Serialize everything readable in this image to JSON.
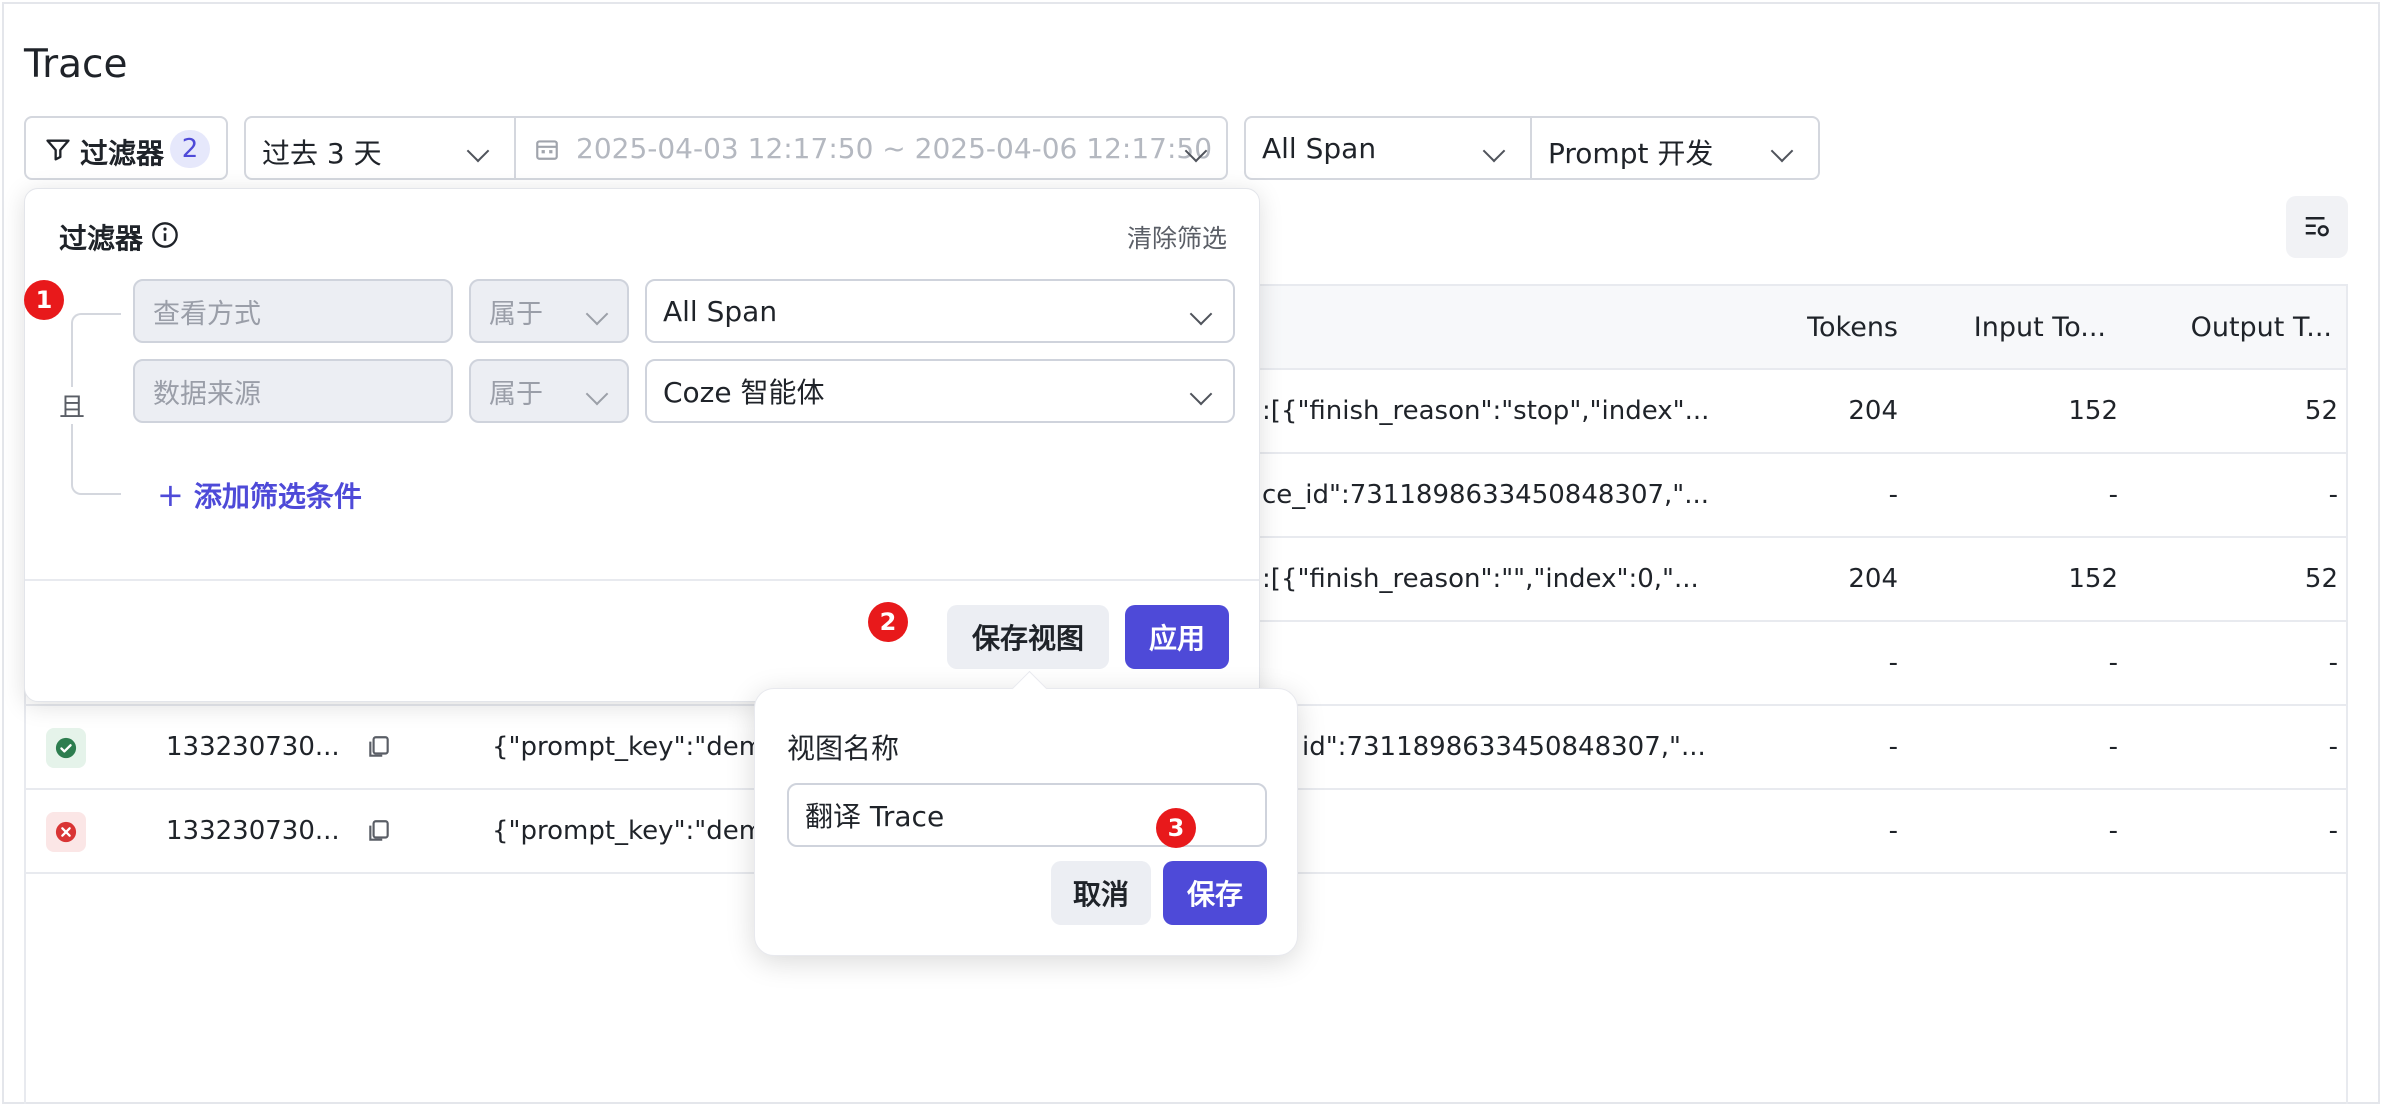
{
  "page": {
    "title": "Trace"
  },
  "toolbar": {
    "filter_label": "过滤器",
    "filter_count": "2",
    "time_range": "过去 3 天",
    "date_range": "2025-04-03 12:17:50 ~ 2025-04-06 12:17:50",
    "span_type": "All Span",
    "platform": "Prompt 开发"
  },
  "table": {
    "headers": {
      "tokens": "Tokens",
      "input_tokens": "Input To...",
      "output_tokens": "Output T..."
    },
    "rows": [
      {
        "status": "",
        "id": "",
        "input": "",
        "output": ":[{\"finish_reason\":\"stop\",\"index\"...",
        "tokens": "204",
        "input_tokens": "152",
        "output_tokens": "52"
      },
      {
        "status": "",
        "id": "",
        "input": "",
        "output": "ce_id\":7311898633450848307,\"...",
        "tokens": "-",
        "input_tokens": "-",
        "output_tokens": "-"
      },
      {
        "status": "",
        "id": "",
        "input": "",
        "output": ":[{\"finish_reason\":\"\",\"index\":0,\"...",
        "tokens": "204",
        "input_tokens": "152",
        "output_tokens": "52"
      },
      {
        "status": "",
        "id": "",
        "input": "",
        "output": "",
        "tokens": "-",
        "input_tokens": "-",
        "output_tokens": "-"
      },
      {
        "status": "success",
        "id": "133230730...",
        "input": "{\"prompt_key\":\"demo",
        "output": "id\":7311898633450848307,\"...",
        "tokens": "-",
        "input_tokens": "-",
        "output_tokens": "-"
      },
      {
        "status": "error",
        "id": "133230730...",
        "input": "{\"prompt_key\":\"demo",
        "output": "",
        "tokens": "-",
        "input_tokens": "-",
        "output_tokens": "-"
      }
    ]
  },
  "filter_panel": {
    "title": "过滤器",
    "clear": "清除筛选",
    "conjunction": "且",
    "conditions": [
      {
        "field": "查看方式",
        "operator": "属于",
        "value": "All Span"
      },
      {
        "field": "数据来源",
        "operator": "属于",
        "value": "Coze 智能体"
      }
    ],
    "add_condition": "添加筛选条件",
    "save_view": "保存视图",
    "apply": "应用"
  },
  "save_popover": {
    "label": "视图名称",
    "name_value": "翻译 Trace",
    "cancel": "取消",
    "save": "保存"
  },
  "annotations": [
    "1",
    "2",
    "3"
  ],
  "colors": {
    "primary": "#4e4ad8",
    "annotation": "#e8191b",
    "success": "#2d7d4f",
    "error": "#d93434"
  }
}
